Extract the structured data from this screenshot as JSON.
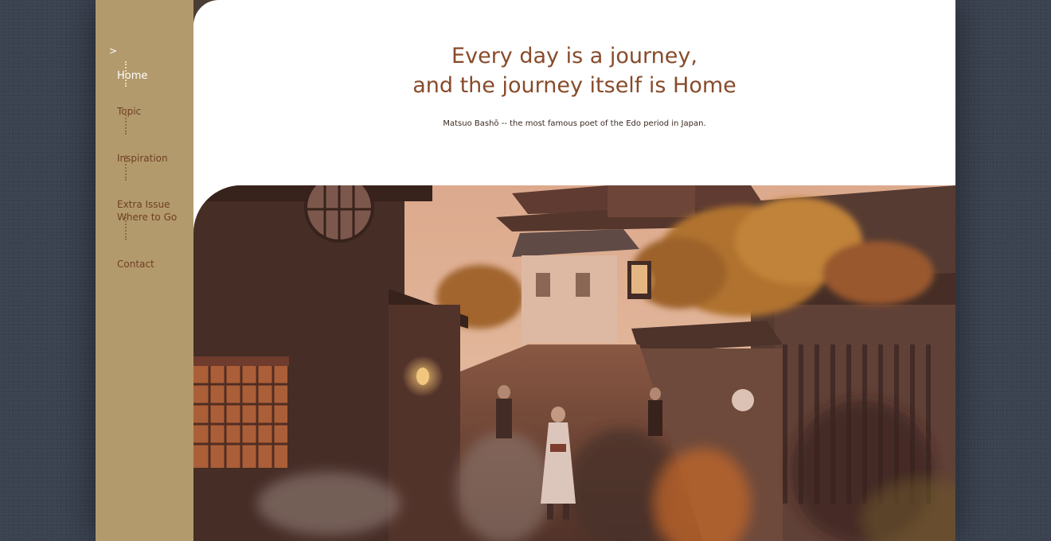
{
  "nav": {
    "items": [
      {
        "label": "Home",
        "active": true
      },
      {
        "label": "Topic",
        "active": false
      },
      {
        "label": "Inspiration",
        "active": false
      },
      {
        "label": "Extra Issue\nWhere to Go",
        "active": false
      },
      {
        "label": "Contact",
        "active": false
      }
    ],
    "active_marker": ">"
  },
  "hero": {
    "headline_line1": "Every day is a journey,",
    "headline_line2": "and the journey itself is Home",
    "attribution": "Matsuo Bashō -- the most famous poet of the Edo period in Japan."
  },
  "colors": {
    "sidebar": "#b39a6d",
    "accent_text": "#874b2b",
    "nav_text": "#6e3f21",
    "background": "#3b4250"
  },
  "image": {
    "subject": "street-photo-kyoto"
  }
}
